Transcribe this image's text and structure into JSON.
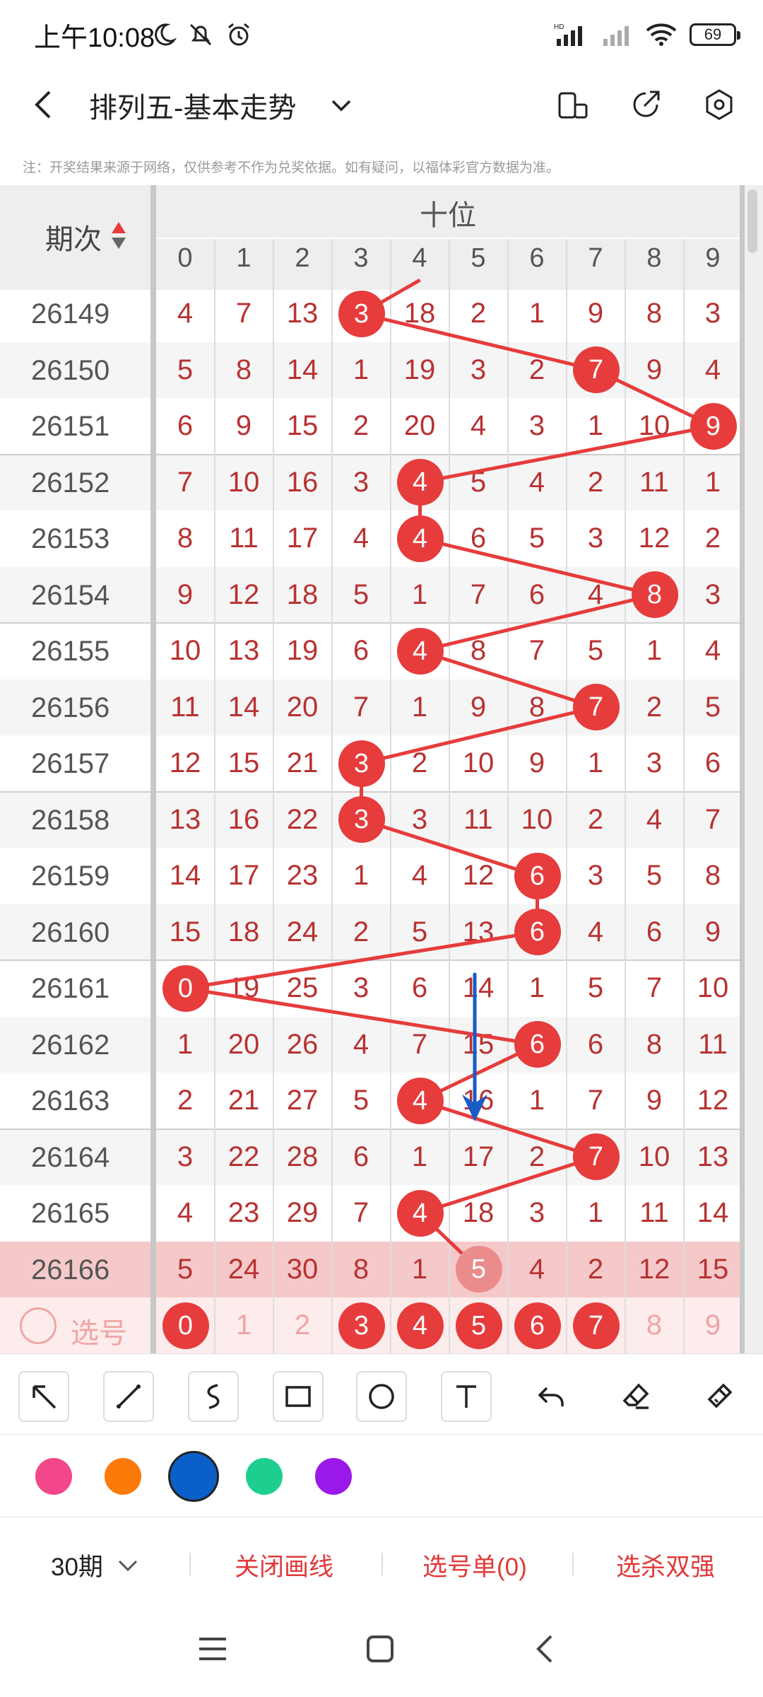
{
  "status_bar": {
    "time": "上午10:08",
    "battery": "69",
    "icons": [
      "moon-icon",
      "mute-icon",
      "alarm-icon",
      "signal-hd-icon",
      "signal-icon",
      "wifi-icon",
      "battery-icon"
    ]
  },
  "header": {
    "title": "排列五-基本走势",
    "icons": [
      "back-icon",
      "dropdown-icon",
      "portrait-icon",
      "share-icon",
      "settings-icon"
    ]
  },
  "notice": "注：开奖结果来源于网络，仅供参考不作为兑奖依据。如有疑问，以福体彩官方数据为准。",
  "table": {
    "issue_header": "期次",
    "group_header": "十位",
    "columns": [
      "0",
      "1",
      "2",
      "3",
      "4",
      "5",
      "6",
      "7",
      "8",
      "9"
    ],
    "rows": [
      {
        "issue": "26149",
        "values": [
          "4",
          "7",
          "13",
          "3",
          "18",
          "2",
          "1",
          "9",
          "8",
          "3"
        ],
        "hit": 3
      },
      {
        "issue": "26150",
        "values": [
          "5",
          "8",
          "14",
          "1",
          "19",
          "3",
          "2",
          "7",
          "9",
          "4"
        ],
        "hit": 7
      },
      {
        "issue": "26151",
        "values": [
          "6",
          "9",
          "15",
          "2",
          "20",
          "4",
          "3",
          "1",
          "10",
          "9"
        ],
        "hit": 9
      },
      {
        "issue": "26152",
        "values": [
          "7",
          "10",
          "16",
          "3",
          "4",
          "5",
          "4",
          "2",
          "11",
          "1"
        ],
        "hit": 4
      },
      {
        "issue": "26153",
        "values": [
          "8",
          "11",
          "17",
          "4",
          "4",
          "6",
          "5",
          "3",
          "12",
          "2"
        ],
        "hit": 4
      },
      {
        "issue": "26154",
        "values": [
          "9",
          "12",
          "18",
          "5",
          "1",
          "7",
          "6",
          "4",
          "8",
          "3"
        ],
        "hit": 8
      },
      {
        "issue": "26155",
        "values": [
          "10",
          "13",
          "19",
          "6",
          "4",
          "8",
          "7",
          "5",
          "1",
          "4"
        ],
        "hit": 4
      },
      {
        "issue": "26156",
        "values": [
          "11",
          "14",
          "20",
          "7",
          "1",
          "9",
          "8",
          "7",
          "2",
          "5"
        ],
        "hit": 7
      },
      {
        "issue": "26157",
        "values": [
          "12",
          "15",
          "21",
          "3",
          "2",
          "10",
          "9",
          "1",
          "3",
          "6"
        ],
        "hit": 3
      },
      {
        "issue": "26158",
        "values": [
          "13",
          "16",
          "22",
          "3",
          "3",
          "11",
          "10",
          "2",
          "4",
          "7"
        ],
        "hit": 3
      },
      {
        "issue": "26159",
        "values": [
          "14",
          "17",
          "23",
          "1",
          "4",
          "12",
          "6",
          "3",
          "5",
          "8"
        ],
        "hit": 6
      },
      {
        "issue": "26160",
        "values": [
          "15",
          "18",
          "24",
          "2",
          "5",
          "13",
          "6",
          "4",
          "6",
          "9"
        ],
        "hit": 6
      },
      {
        "issue": "26161",
        "values": [
          "0",
          "19",
          "25",
          "3",
          "6",
          "14",
          "1",
          "5",
          "7",
          "10"
        ],
        "hit": 0
      },
      {
        "issue": "26162",
        "values": [
          "1",
          "20",
          "26",
          "4",
          "7",
          "15",
          "6",
          "6",
          "8",
          "11"
        ],
        "hit": 6
      },
      {
        "issue": "26163",
        "values": [
          "2",
          "21",
          "27",
          "5",
          "4",
          "16",
          "1",
          "7",
          "9",
          "12"
        ],
        "hit": 4
      },
      {
        "issue": "26164",
        "values": [
          "3",
          "22",
          "28",
          "6",
          "1",
          "17",
          "2",
          "7",
          "10",
          "13"
        ],
        "hit": 7
      },
      {
        "issue": "26165",
        "values": [
          "4",
          "23",
          "29",
          "7",
          "4",
          "18",
          "3",
          "1",
          "11",
          "14"
        ],
        "hit": 4
      },
      {
        "issue": "26166",
        "values": [
          "5",
          "24",
          "30",
          "8",
          "1",
          "5",
          "4",
          "2",
          "12",
          "15"
        ],
        "hit": 5
      }
    ],
    "pick_row": {
      "label": "选号",
      "values": [
        "0",
        "1",
        "2",
        "3",
        "4",
        "5",
        "6",
        "7",
        "8",
        "9"
      ],
      "selected": [
        0,
        3,
        4,
        5,
        6,
        7
      ]
    }
  },
  "toolbar": {
    "tools": [
      "arrow-tool-icon",
      "line-tool-icon",
      "curve-tool-icon",
      "rectangle-tool-icon",
      "circle-tool-icon",
      "text-tool-icon",
      "undo-icon",
      "eraser-icon",
      "clear-brush-icon"
    ]
  },
  "palette": {
    "colors": [
      "#f2478a",
      "#fb7a0a",
      "#0b5fc9",
      "#1dcf8e",
      "#9a18e8"
    ],
    "selected": 2
  },
  "bottom_bar": {
    "period": "30期",
    "close_lines": "关闭画线",
    "pick_list": "选号单(0)",
    "filter": "选杀双强"
  },
  "colors": {
    "accent": "#e63c3c",
    "number_text": "#b83232",
    "annotation": "#1a5bc4"
  }
}
